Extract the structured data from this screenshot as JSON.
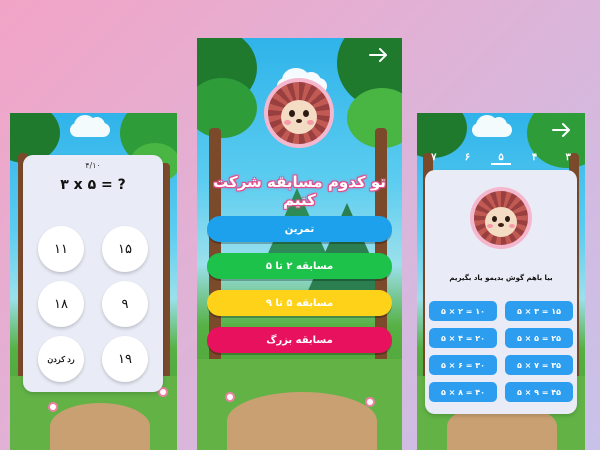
{
  "colors": {
    "accent_blue": "#1da1ec",
    "accent_green": "#1cc24a",
    "accent_yellow": "#ffd21a",
    "accent_pink": "#e8115e",
    "card_bg": "#e9ecf6"
  },
  "quiz": {
    "progress": "۴/۱۰",
    "question": "۳ x ۵ = ?",
    "answers": [
      "۱۵",
      "۱۱",
      "۹",
      "۱۸",
      "۱۹"
    ],
    "skip_label": "رد کردن"
  },
  "menu": {
    "title": "تو کدوم مسابقه شرکت کنیم",
    "buttons": [
      "تمرین",
      "مسابقه ۲ تا ۵",
      "مسابقه ۵ تا ۹",
      "مسابقه بزرگ"
    ]
  },
  "table": {
    "tabs": [
      "۳",
      "۴",
      "۵",
      "۶",
      "۷"
    ],
    "active_tab": "۵",
    "caption": "بیا باهم گوش بدیمو یاد بگیریم",
    "facts": [
      "۵ × ۳ = ۱۵",
      "۵ × ۲ = ۱۰",
      "۵ × ۵ = ۲۵",
      "۵ × ۴ = ۲۰",
      "۵ × ۷ = ۳۵",
      "۵ × ۶ = ۳۰",
      "۵ × ۹ = ۴۵",
      "۵ × ۸ = ۴۰"
    ]
  },
  "icons": {
    "back": "arrow-right-icon",
    "mascot": "hedgehog-icon"
  }
}
